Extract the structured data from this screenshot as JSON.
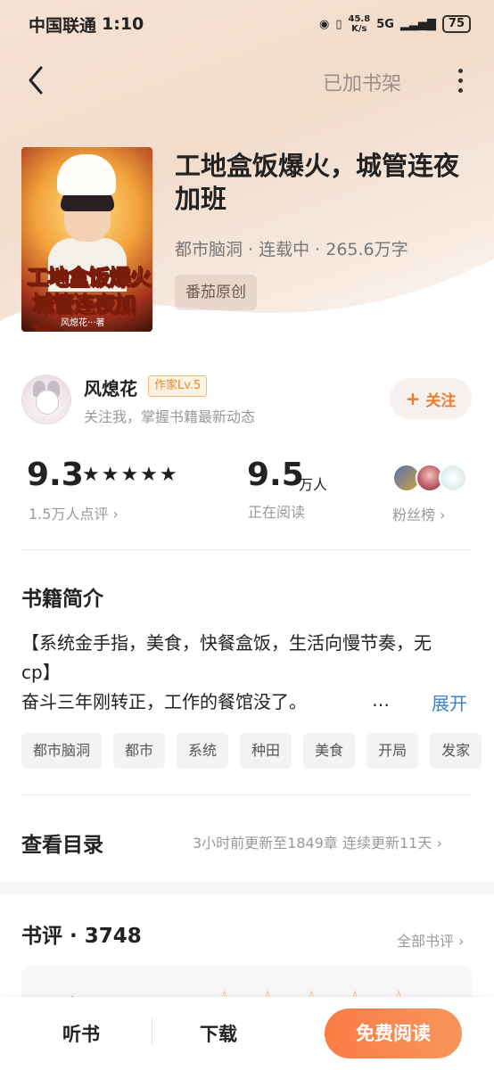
{
  "status_bar": {
    "carrier": "中国联通",
    "time": "1:10",
    "net_speed_value": "45.8",
    "net_speed_unit": "K/s",
    "network": "5G",
    "battery": "75"
  },
  "nav": {
    "shelf_status": "已加书架"
  },
  "book": {
    "title": "工地盒饭爆火，城管连夜加班",
    "meta": "都市脑洞 · 连载中 · 265.6万字",
    "badge": "番茄原创",
    "cover_title_line1": "工地盒饭爆火",
    "cover_title_line2": "城管连夜加班",
    "cover_author": "风熄花···著"
  },
  "author": {
    "name": "风熄花",
    "level": "作家Lv.5",
    "desc": "关注我，掌握书籍最新动态",
    "follow_label": "关注"
  },
  "stats": {
    "score": "9.3",
    "stars": "★★★★★",
    "rating_count": "1.5万人点评",
    "readers": "9.5",
    "readers_unit": "万人",
    "readers_label": "正在阅读",
    "fans_label": "粉丝榜"
  },
  "synopsis": {
    "title": "书籍简介",
    "line1": "【系统金手指，美食，快餐盒饭，生活向慢节奏，无cp】",
    "line2": "奋斗三年刚转正，工作的餐馆没了。",
    "ellipsis": "…",
    "expand_label": "展开",
    "tags": [
      "都市脑洞",
      "都市",
      "系统",
      "种田",
      "美食",
      "开局",
      "发家"
    ]
  },
  "catalog": {
    "title": "查看目录",
    "update_info": "3小时前更新至1849章 连续更新11天"
  },
  "reviews": {
    "title": "书评 · 3748",
    "more_label": "全部书评",
    "prompt": "都来评分",
    "empty_stars": "☆☆☆☆☆"
  },
  "bottom_bar": {
    "listen": "听书",
    "download": "下载",
    "read": "免费阅读"
  },
  "colors": {
    "accent": "#ec7a2b",
    "link": "#3d7fcf",
    "read_button": "#fb7c45"
  }
}
